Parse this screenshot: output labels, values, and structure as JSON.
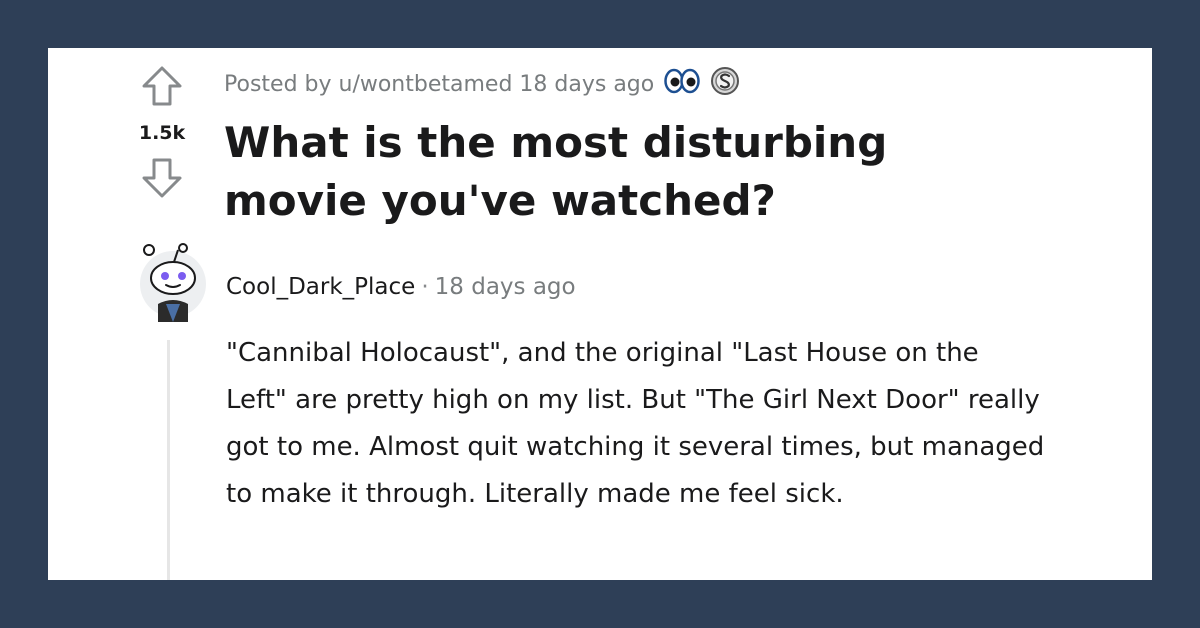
{
  "post": {
    "meta": "Posted by u/wontbetamed 18 days ago",
    "score": "1.5k",
    "title": "What is the most disturbing movie you've watched?"
  },
  "comment": {
    "author": "Cool_Dark_Place",
    "separator": "·",
    "time": "18 days ago",
    "body": "\"Cannibal Holocaust\", and the original \"Last House on the Left\" are pretty high on my list. But \"The Girl Next Door\" really got to me. Almost quit watching it several times, but managed to make it through. Literally made me feel sick."
  },
  "icons": {
    "upvote": "upvote-arrow-icon",
    "downvote": "downvote-arrow-icon",
    "award_1": "eyes-award-icon",
    "award_2": "silver-coin-award-icon",
    "avatar": "snoo-avatar-icon"
  },
  "colors": {
    "frame": "#2e3f57",
    "card": "#ffffff",
    "text_primary": "#1a1a1b",
    "text_meta": "#787c7e",
    "avatar_purple": "#7b5cf0"
  }
}
